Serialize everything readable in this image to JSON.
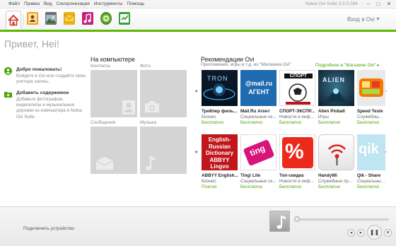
{
  "menu": [
    "Файл",
    "Правка",
    "Вид",
    "Синхронизация",
    "Инструменты",
    "Помощь"
  ],
  "app_title": "Nokia Ovi Suite 3.0.0.284",
  "window_controls": {
    "minimize": "–",
    "maximize": "□",
    "close": "✕"
  },
  "toolbar": {
    "icons": [
      "home-icon",
      "contacts-icon",
      "photos-icon",
      "messages-icon",
      "music-icon",
      "ovi-store-icon",
      "sync-icon"
    ],
    "signin_label": "Вход в Ovi",
    "signin_arrow": "▼"
  },
  "left_panel": {
    "greeting": "Привет, Hei!",
    "items": [
      {
        "title": "Добро пожаловать!",
        "desc": "Войдите в Ovi или создайте свою учетную запись.",
        "icon": "user-icon"
      },
      {
        "title": "Добавить содержимое",
        "desc": "Добавьте фотографии, видеоклипы и музыкальные дорожки из компьютера в Nokia Ovi Suite.",
        "icon": "add-folder-icon"
      }
    ]
  },
  "computer": {
    "title": "На компьютере",
    "tiles": [
      {
        "label": "Контакты",
        "icon": "contacts-icon"
      },
      {
        "label": "Фото",
        "icon": "camera-icon"
      },
      {
        "label": "Сообщения",
        "icon": "envelope-icon"
      },
      {
        "label": "Музыка",
        "icon": "music-note-icon"
      }
    ]
  },
  "recommendations": {
    "title": "Рекомендации Ovi",
    "subtitle": "Приложения, игры и т.д. из \"Магазина Ovi\"",
    "more_link": "Подробнее в \"Магазине Ovi\" ▸",
    "scroll_left": "◂",
    "scroll_right": "▸",
    "apps": [
      {
        "name": "Трейлер филь...",
        "category": "Бизнес",
        "price": "Бесплатно",
        "image_text": "TRON"
      },
      {
        "name": "Mail.Ru Агент",
        "category": "Социальные се...",
        "price": "Бесплатно",
        "image_text": "@mail.ru АГЕНТ"
      },
      {
        "name": "СПОРТ-ЭКСПР...",
        "category": "Новости и инф...",
        "price": "Бесплатно",
        "image_text": "СПОРТ"
      },
      {
        "name": "Alien Pinball",
        "category": "Игры",
        "price": "Бесплатно",
        "image_text": "ALIEN"
      },
      {
        "name": "Speed Teste",
        "category": "Служебные пр...",
        "price": "Бесплатно",
        "image_text": ""
      },
      {
        "name": "ABBYY English...",
        "category": "Бизнес",
        "price": "Платно",
        "image_text": "English- Russian Dictionary ABBYY Lingvo"
      },
      {
        "name": "Ting! Lite",
        "category": "Социальные се...",
        "price": "Бесплатно",
        "image_text": "ting"
      },
      {
        "name": "Топ-скидка",
        "category": "Новости и инф...",
        "price": "Бесплатно",
        "image_text": "%"
      },
      {
        "name": "HandyWi",
        "category": "Служебные пр...",
        "price": "Бесплатно",
        "image_text": ""
      },
      {
        "name": "Qik - Share",
        "category": "Социальные се...",
        "price": "Бесплатно",
        "image_text": "qik"
      }
    ]
  },
  "bottom": {
    "connect_label": "Подключить устройство",
    "player": {
      "prev": "◂",
      "next": "▸",
      "pause": "❚❚",
      "menu": "▾"
    }
  }
}
